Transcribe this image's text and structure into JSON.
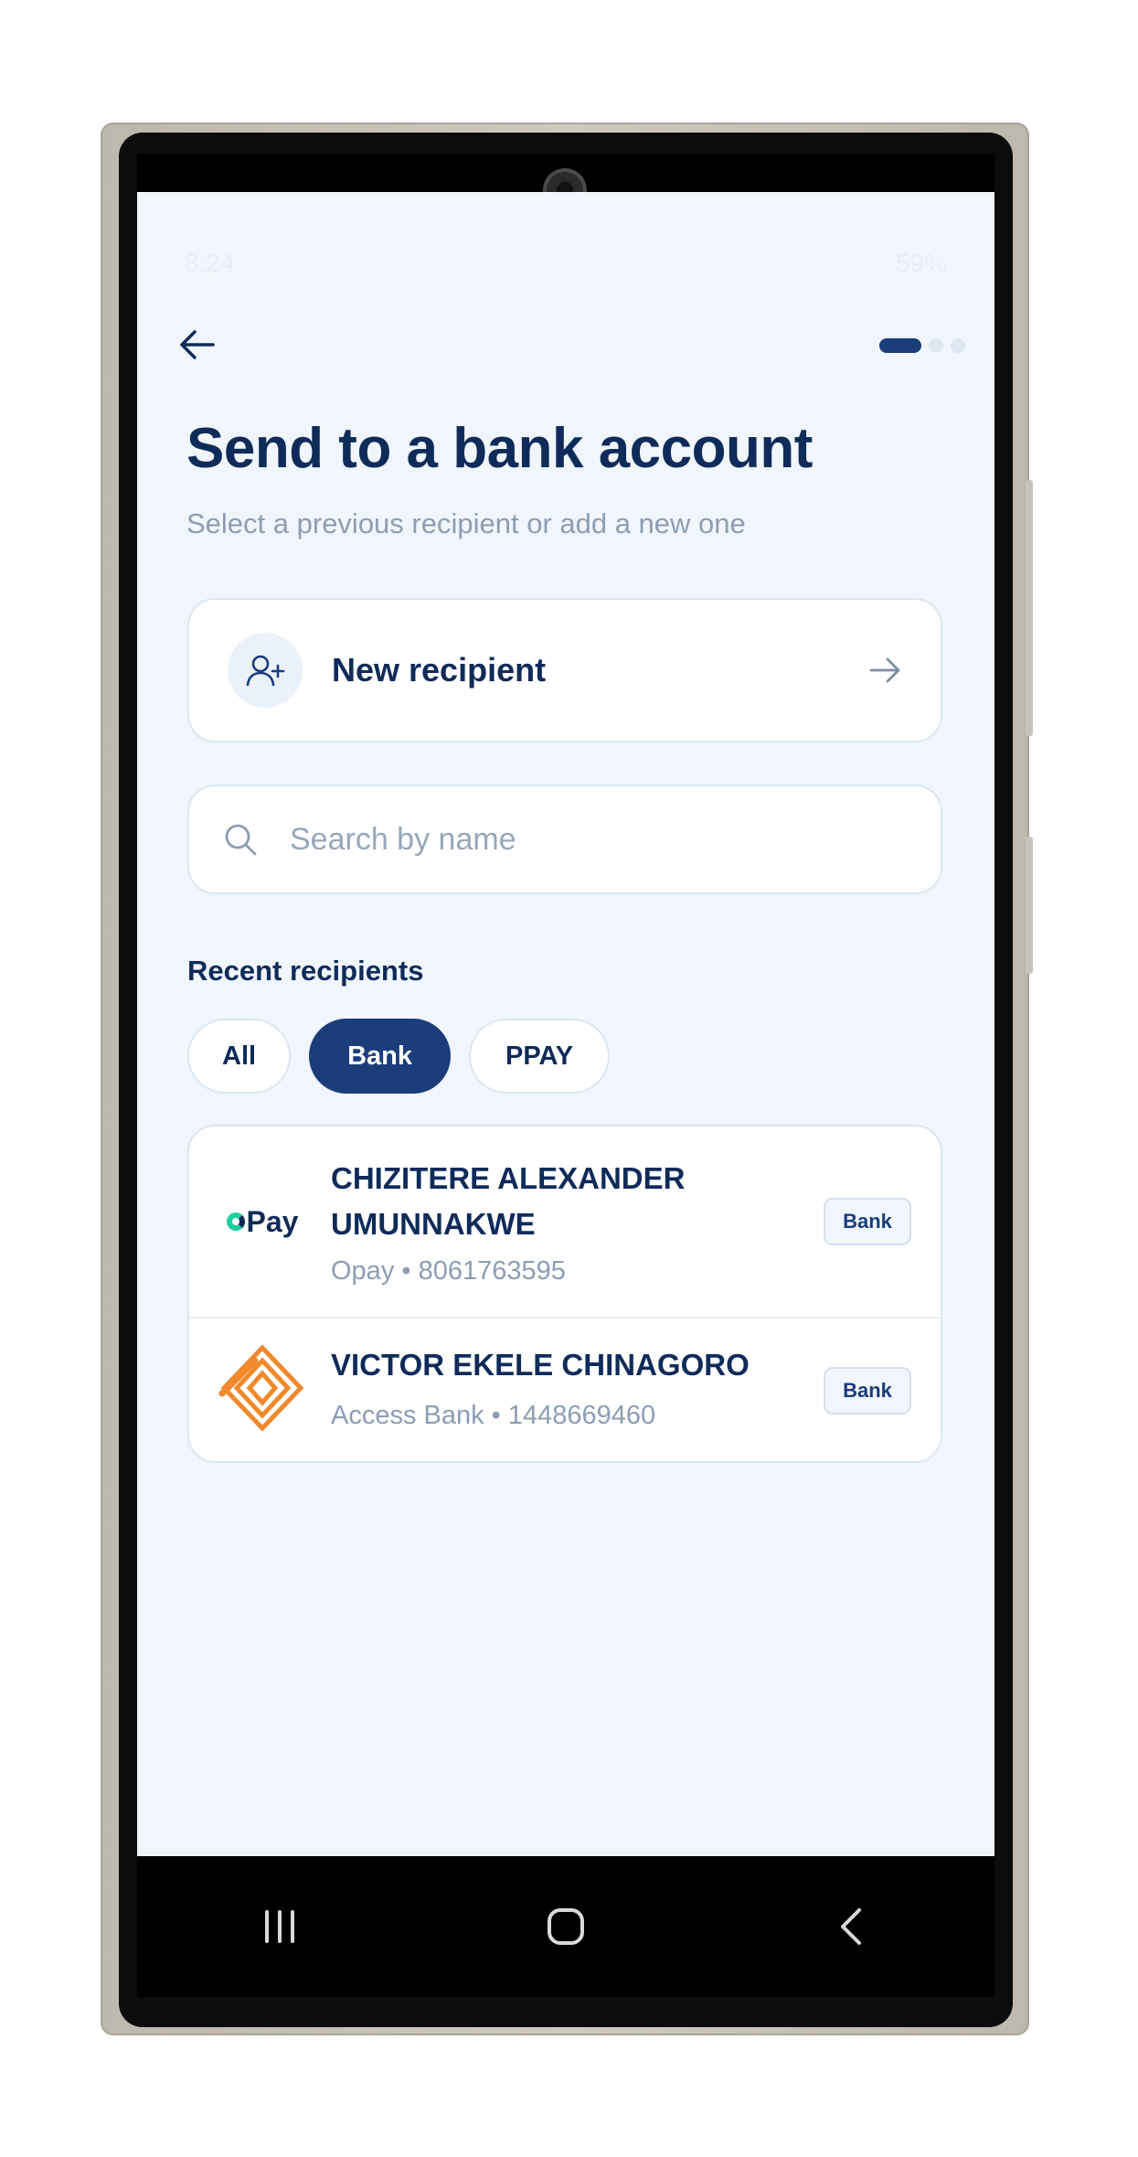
{
  "status_bar": {
    "time": "8:24",
    "battery": "59%"
  },
  "header": {
    "title": "Send to a bank account",
    "subtitle": "Select a previous recipient or add a new one"
  },
  "new_recipient": {
    "label": "New recipient"
  },
  "search": {
    "placeholder": "Search by name",
    "value": ""
  },
  "recent": {
    "title": "Recent recipients",
    "filters": [
      {
        "label": "All",
        "selected": false
      },
      {
        "label": "Bank",
        "selected": true
      },
      {
        "label": "PPAY",
        "selected": false
      }
    ],
    "items": [
      {
        "name": "CHIZITERE ALEXANDER UMUNNAKWE",
        "detail": "Opay • 8061763595",
        "tag": "Bank",
        "logo": "Pay"
      },
      {
        "name": "VICTOR EKELE CHINAGORO",
        "detail": "Access Bank • 1448669460",
        "tag": "Bank"
      }
    ]
  },
  "colors": {
    "primary": "#1b3d7a",
    "text": "#0f2b59",
    "muted": "#8d9db3",
    "background": "#f1f6fc",
    "opay_green": "#1dcf9f",
    "access_orange": "#f08a2c"
  },
  "icons": [
    "back-arrow-icon",
    "add-user-icon",
    "arrow-right-icon",
    "search-icon",
    "opay-logo",
    "access-bank-logo",
    "recents-icon",
    "home-icon",
    "back-icon"
  ]
}
